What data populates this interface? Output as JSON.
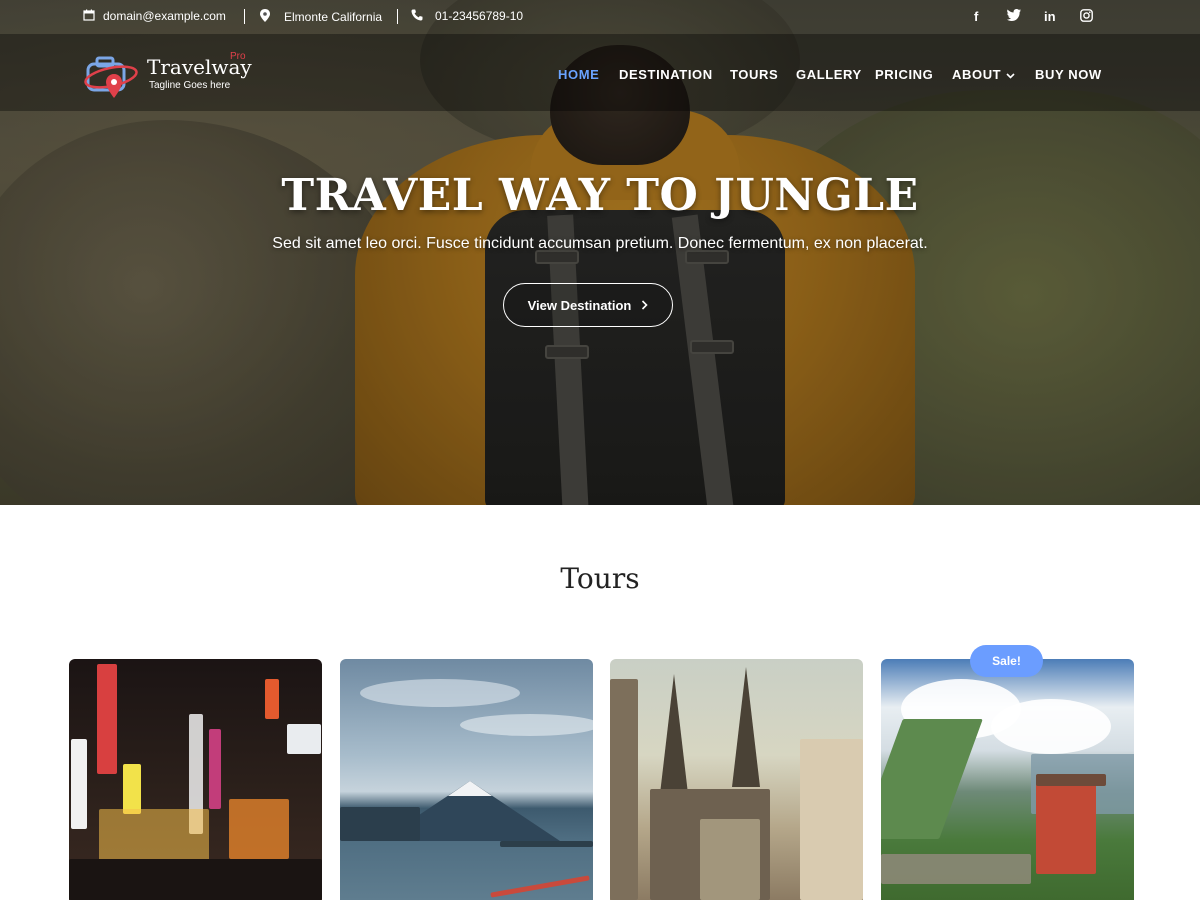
{
  "topbar": {
    "email": "domain@example.com",
    "location": "Elmonte California",
    "phone": "01-23456789-10",
    "social": [
      "facebook",
      "twitter",
      "linkedin",
      "instagram"
    ]
  },
  "logo": {
    "name": "Travelway",
    "badge": "Pro",
    "tagline": "Tagline Goes here"
  },
  "nav": {
    "items": [
      {
        "label": "HOME",
        "active": true
      },
      {
        "label": "DESTINATION"
      },
      {
        "label": "TOURS"
      },
      {
        "label": "GALLERY"
      },
      {
        "label": "PRICING"
      },
      {
        "label": "ABOUT"
      },
      {
        "label": "BUY NOW"
      }
    ],
    "active_color": "#6aa3ff"
  },
  "hero": {
    "title": "TRAVEL WAY TO JUNGLE",
    "subtitle": "Sed sit amet leo orci. Fusce tincidunt accumsan pretium. Donec fermentum, ex non placerat.",
    "button_label": "View Destination"
  },
  "tours": {
    "title": "Tours",
    "sale_badge": "Sale!",
    "accent": "#6b9dff"
  },
  "icons": {
    "email": "calendar-icon",
    "location": "map-pin-icon",
    "phone": "phone-icon",
    "chevron": "chevron-right-icon"
  }
}
